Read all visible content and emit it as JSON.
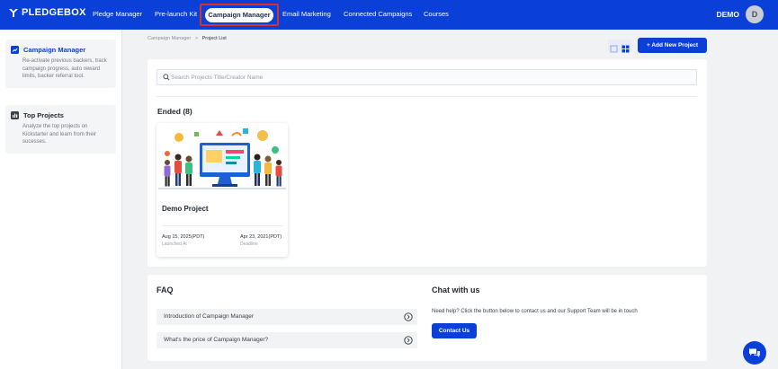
{
  "app": {
    "brand": "PLEDGEBOX"
  },
  "nav": {
    "items": [
      "Pledge Manager",
      "Pre-launch Kit",
      "Campaign Manager",
      "Email Marketing",
      "Connected Campaigns",
      "Courses"
    ],
    "active": "Campaign Manager",
    "user_name": "DEMO",
    "avatar_initial": "D"
  },
  "sidebar": {
    "items": [
      {
        "title": "Campaign Manager",
        "description": "Re-activate previous backers, track campaign progress, auto reward limits, backer referral tool.",
        "icon": "chart-icon"
      },
      {
        "title": "Top Projects",
        "description": "Analyze the top projects on Kickstarter and learn from their sucesses.",
        "icon": "bars-icon"
      }
    ]
  },
  "breadcrumb": {
    "parent": "Campaign Manager",
    "separator": ">",
    "current": "Project List"
  },
  "toolbar": {
    "add_label": "+ Add New Project"
  },
  "search": {
    "placeholder": "Search Projects Title/Creator Name",
    "value": ""
  },
  "projects": {
    "section_title": "Ended (8)",
    "items": [
      {
        "name": "Demo Project",
        "launched": "Aug 15, 2025(PDT)",
        "launched_label": "Launched At",
        "deadline": "Apr 23, 2021(PDT)",
        "deadline_label": "Deadline"
      }
    ]
  },
  "faq": {
    "title": "FAQ",
    "items": [
      "Introduction of Campaign Manager",
      "What's the price of Campaign Manager?"
    ]
  },
  "chat": {
    "title": "Chat with us",
    "text": "Need help? Click the button below to contact us and our Support Team will be in touch",
    "button_label": "Contact Us"
  },
  "colors": {
    "primary": "#0a3fd8",
    "highlight": "#d9302b",
    "background": "#f1f2f4"
  }
}
